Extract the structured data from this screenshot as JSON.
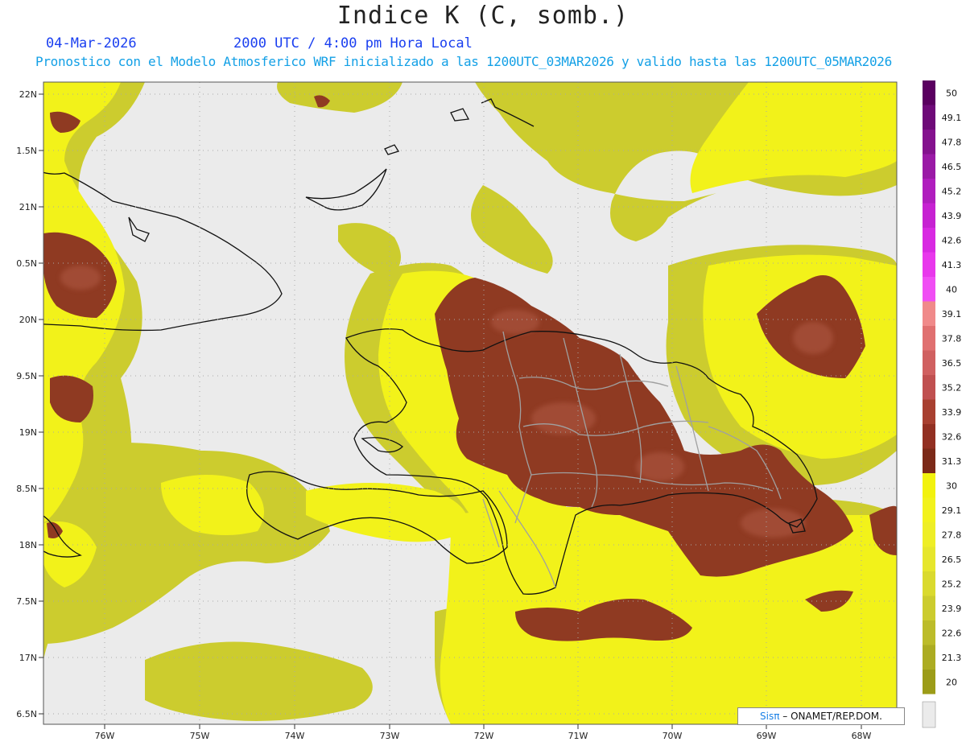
{
  "header": {
    "title": "Indice K (C, somb.)",
    "date": "04-Mar-2026",
    "time": "2000 UTC / 4:00 pm Hora Local",
    "forecast_line": "Pronostico con el Modelo Atmosferico WRF inicializado a las 1200UTC_03MAR2026 y valido hasta las  1200UTC_05MAR2026"
  },
  "axes": {
    "lat_labels": [
      "22N",
      "1.5N",
      "21N",
      "0.5N",
      "20N",
      "9.5N",
      "19N",
      "8.5N",
      "18N",
      "7.5N",
      "17N",
      "6.5N"
    ],
    "lon_labels": [
      "76W",
      "75W",
      "74W",
      "73W",
      "72W",
      "71W",
      "70W",
      "69W",
      "68W"
    ]
  },
  "colorbar": {
    "labels": [
      "50",
      "49.1",
      "47.8",
      "46.5",
      "45.2",
      "43.9",
      "42.6",
      "41.3",
      "40",
      "39.1",
      "37.8",
      "36.5",
      "35.2",
      "33.9",
      "32.6",
      "31.3",
      "30",
      "29.1",
      "27.8",
      "26.5",
      "25.2",
      "23.9",
      "22.6",
      "21.3",
      "20"
    ],
    "colors": [
      "#5a0060",
      "#6e0a78",
      "#84128e",
      "#9a1aa6",
      "#b01ebe",
      "#c622d2",
      "#d82ae2",
      "#e838ec",
      "#f04ef4",
      "#f08a8a",
      "#e07070",
      "#d06060",
      "#c05050",
      "#a84030",
      "#923022",
      "#7c2a18",
      "#f2f20e",
      "#f2f21c",
      "#eeee26",
      "#e6e62c",
      "#dada2e",
      "#cccc2e",
      "#bcbc2a",
      "#acac22",
      "#9c9c18"
    ],
    "bottom_color": "#ebebeb"
  },
  "colors": {
    "background": "#ebebeb",
    "low_k": "#cccc2e",
    "mid_k": "#f2f21a",
    "high_k": "#8f3a22",
    "coast": "#111111",
    "borders": "#a0a0a0"
  },
  "credit": {
    "logo": "Sisπ",
    "org": " – ONAMET/REP.DOM."
  }
}
